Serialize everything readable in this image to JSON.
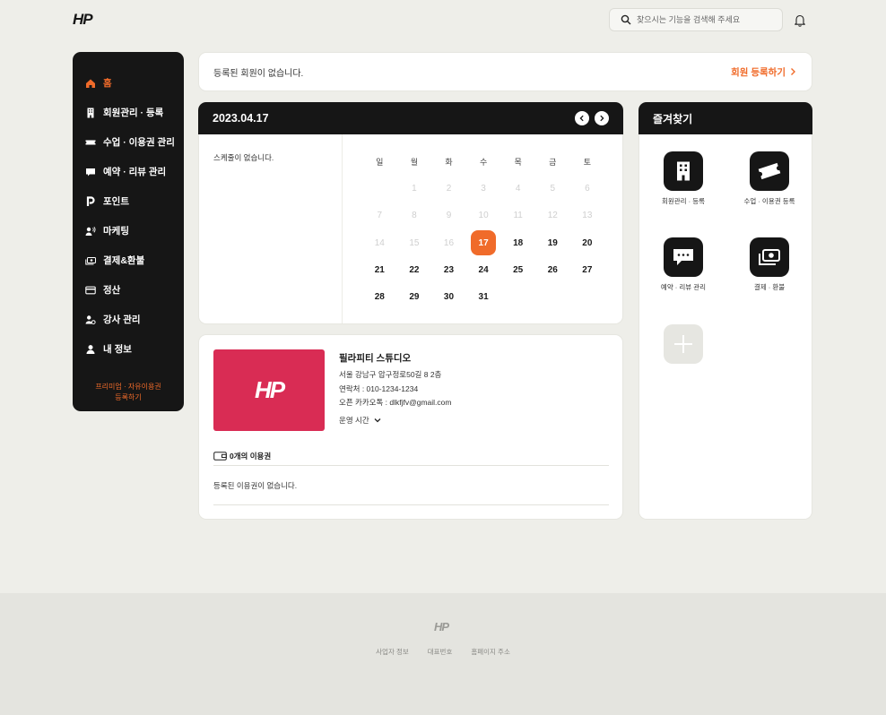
{
  "header": {
    "logo": "HP",
    "search_placeholder": "찾으시는 기능을 검색해 주세요"
  },
  "sidebar": {
    "items": [
      {
        "label": "홈",
        "icon": "home-icon",
        "active": true
      },
      {
        "label": "회원관리 · 등록",
        "icon": "building-icon"
      },
      {
        "label": "수업 · 이용권 관리",
        "icon": "ticket-icon"
      },
      {
        "label": "예약 · 리뷰 관리",
        "icon": "chat-icon"
      },
      {
        "label": "포인트",
        "icon": "point-icon"
      },
      {
        "label": "마케팅",
        "icon": "marketing-icon"
      },
      {
        "label": "결제&환불",
        "icon": "money-icon"
      },
      {
        "label": "정산",
        "icon": "card-icon"
      },
      {
        "label": "강사 관리",
        "icon": "instructor-icon"
      },
      {
        "label": "내 정보",
        "icon": "user-icon"
      }
    ],
    "premium_line1": "프리미엄 · 자유이용권",
    "premium_line2": "등록하기"
  },
  "notice": {
    "message": "등록된 회원이 없습니다.",
    "link_label": "회원 등록하기"
  },
  "calendar": {
    "date": "2023.04.17",
    "schedule_empty": "스케줄이 없습니다.",
    "weekdays": [
      "일",
      "월",
      "화",
      "수",
      "목",
      "금",
      "토"
    ],
    "days": [
      [
        "",
        "",
        "",
        "",
        "",
        "",
        ""
      ],
      [
        "1",
        "2",
        "3",
        "4",
        "5",
        "6",
        "7"
      ]
    ],
    "first_day_offset": 1,
    "days_in_month": 31,
    "today": 17
  },
  "favorites": {
    "title": "즐겨찾기",
    "items": [
      {
        "label": "회원관리 · 등록",
        "icon": "building-icon"
      },
      {
        "label": "수업 · 이용권 등록",
        "icon": "ticket-icon"
      },
      {
        "label": "예약 · 리뷰 관리",
        "icon": "chat-icon"
      },
      {
        "label": "결제 · 환불",
        "icon": "money-icon"
      }
    ]
  },
  "studio": {
    "logo": "HP",
    "name": "필라피티 스튜디오",
    "address": "서울 강남구 압구정로50길 8 2층",
    "phone": "연락처 : 010-1234-1234",
    "kakao": "오픈 카카오톡 : dlkfjfv@gmail.com",
    "hours_label": "운영 시간",
    "pass_title": "0개의 이용권",
    "pass_empty": "등록된 이용권이 없습니다."
  },
  "footer": {
    "logo": "HP",
    "links": [
      "사업자 정보",
      "대표번호",
      "홈페이지 주소"
    ]
  },
  "colors": {
    "accent": "#f06b2a",
    "dark": "#161616",
    "studio_brand": "#d92c54",
    "background": "#eeeee9"
  }
}
